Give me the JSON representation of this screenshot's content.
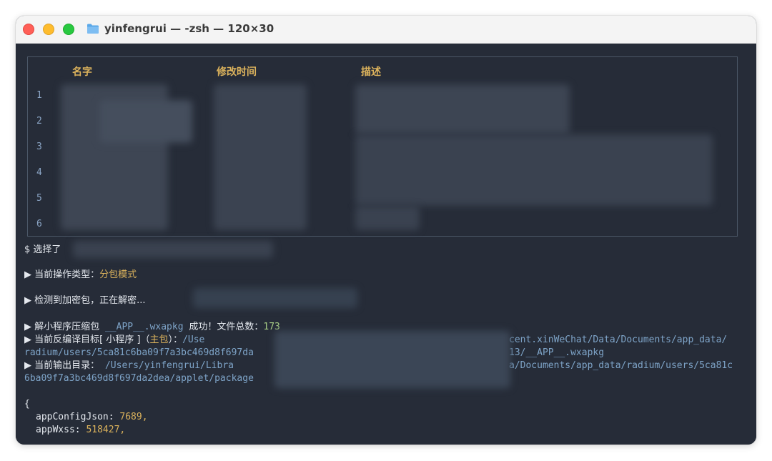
{
  "window": {
    "title": "yinfengrui — -zsh — 120×30"
  },
  "table": {
    "headers": [
      "名字",
      "修改时间",
      "描述"
    ],
    "row_numbers": [
      "1",
      "2",
      "3",
      "4",
      "5",
      "6"
    ]
  },
  "output": {
    "prompt": "$ 选择了",
    "op_type_prefix": "▶ 当前操作类型：",
    "op_type_value": "分包模式",
    "detect": "▶ 检测到加密包，正在解密...",
    "unpack_prefix": "▶ 解小程序压缩包",
    "unpack_file": "__APP__.wxapkg",
    "unpack_success": "成功！文件总数：",
    "unpack_count": "173",
    "target_prefix": "▶ 当前反编译目标[ 小程序 ]（",
    "target_main": "主包",
    "target_suffix": "）：",
    "target_path_start": "/Use",
    "target_path_end": "cent.xinWeChat/Data/Documents/app_data/",
    "target_path2_start": "radium/users/5ca81c6ba09f7a3bc469d8f697da",
    "target_path2_end": "13/__APP__.wxapkg",
    "outdir_prefix": "▶ 当前输出目录：",
    "outdir_path_start": "/Users/yinfengrui/Libra",
    "outdir_path_end": "a/Documents/app_data/radium/users/5ca81c",
    "outdir_path2": "6ba09f7a3bc469d8f697da2dea/applet/package",
    "brace_open": "{",
    "kv": [
      {
        "key": "appConfigJson:",
        "value": "7689,"
      },
      {
        "key": "appWxss:",
        "value": "518427,"
      }
    ]
  }
}
